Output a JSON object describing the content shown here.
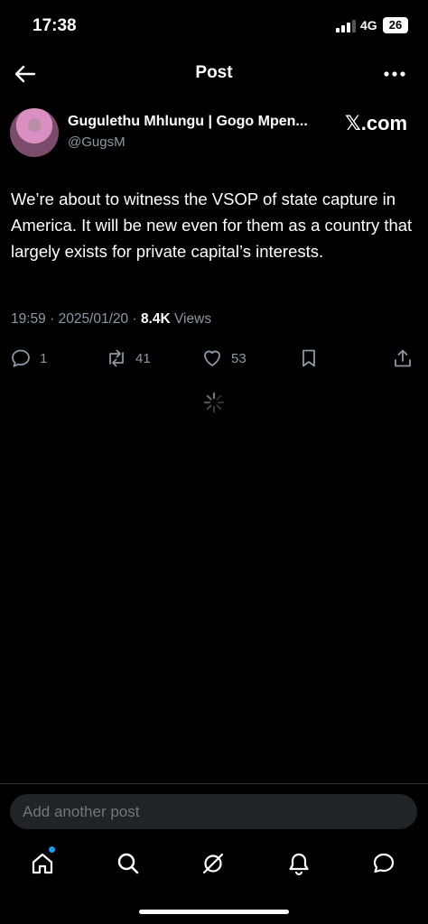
{
  "status_bar": {
    "time": "17:38",
    "network": "4G",
    "battery": "26"
  },
  "header": {
    "title": "Post"
  },
  "author": {
    "name": "Gugulethu Mhlungu | Gogo Mpen...",
    "handle": "@GugsM",
    "source_badge": "𝕏.com"
  },
  "post": {
    "text": "We’re about to witness the VSOP of state capture in America. It will be new even for them as a country that largely exists for private capital’s interests.",
    "time": "19:59",
    "date": "2025/01/20",
    "views_count": "8.4K",
    "views_label": "Views"
  },
  "actions": {
    "replies": "1",
    "reposts": "41",
    "likes": "53"
  },
  "composer": {
    "placeholder": "Add another post"
  },
  "colors": {
    "background": "#000000",
    "muted": "#8b98a5",
    "accent": "#1d9bf0"
  },
  "icons": [
    "back-arrow-icon",
    "more-icon",
    "reply-icon",
    "repost-icon",
    "like-icon",
    "bookmark-icon",
    "share-icon",
    "loading-spinner-icon",
    "home-icon",
    "search-icon",
    "grok-icon",
    "notifications-icon",
    "messages-icon"
  ]
}
